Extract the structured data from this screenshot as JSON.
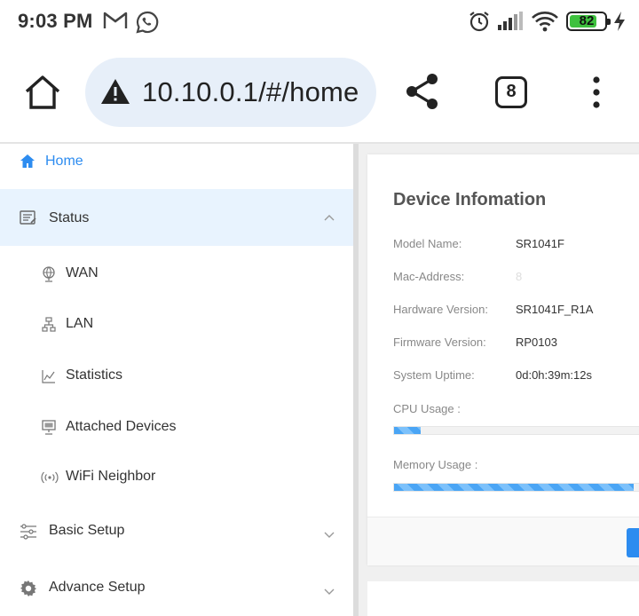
{
  "status_bar": {
    "time": "9:03 PM",
    "notifications": [
      "gmail-icon",
      "whatsapp-icon"
    ],
    "system_icons": [
      "alarm-icon",
      "signal-icon",
      "wifi-icon",
      "battery-icon",
      "charging-icon"
    ],
    "battery_level": "82",
    "battery_fraction": 0.82
  },
  "browser": {
    "url": "10.10.0.1/#/home",
    "tab_count": "8",
    "security": "warning-icon"
  },
  "sidebar": {
    "home": {
      "label": "Home",
      "icon": "home-icon"
    },
    "status": {
      "label": "Status",
      "icon": "status-icon",
      "expanded": true
    },
    "sub_items": [
      {
        "label": "WAN",
        "icon": "globe-icon"
      },
      {
        "label": "LAN",
        "icon": "network-icon"
      },
      {
        "label": "Statistics",
        "icon": "chart-icon"
      },
      {
        "label": "Attached Devices",
        "icon": "monitor-icon"
      },
      {
        "label": "WiFi Neighbor",
        "icon": "wifi-signal-icon"
      }
    ],
    "basic_setup": {
      "label": "Basic Setup",
      "icon": "sliders-icon"
    },
    "advance_setup": {
      "label": "Advance Setup",
      "icon": "gear-icon"
    }
  },
  "device_info": {
    "title": "Device Infomation",
    "rows": [
      {
        "label": "Model Name:",
        "value": "SR1041F"
      },
      {
        "label": "Mac-Address:",
        "value": "8"
      },
      {
        "label": "Hardware Version:",
        "value": "SR1041F_R1A"
      },
      {
        "label": "Firmware Version:",
        "value": "RP0103"
      },
      {
        "label": "System Uptime:",
        "value": "0d:0h:39m:12s"
      }
    ],
    "cpu_label": "CPU Usage :",
    "cpu_usage": 0.11,
    "memory_label": "Memory Usage :",
    "memory_usage": 0.98
  },
  "colors": {
    "accent": "#2d8cf0",
    "active_bg": "#e8f3fe",
    "progress": "#4aa5f5"
  }
}
